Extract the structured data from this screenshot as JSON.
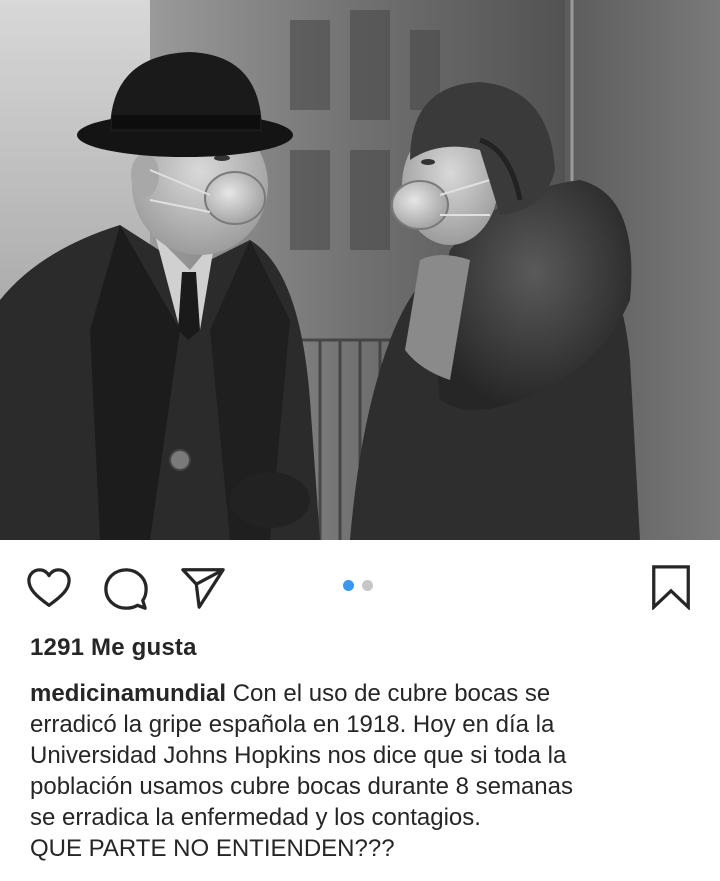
{
  "post": {
    "image": {
      "alt": "",
      "style": "black-and-white"
    },
    "actions": {
      "like_icon": "heart-icon",
      "comment_icon": "comment-icon",
      "share_icon": "send-icon",
      "save_icon": "bookmark-icon"
    },
    "carousel": {
      "total": 2,
      "active_index": 0,
      "active_color": "#3897f0",
      "inactive_color": "#c7c7c7"
    },
    "likes_text": "1291 Me gusta",
    "caption": {
      "username": "medicinamundial",
      "first_line": "Con el uso de cubre bocas se",
      "lines": [
        "erradicó la gripe española en 1918. Hoy en día la",
        "Universidad Johns Hopkins nos dice que si toda la",
        "población usamos cubre bocas durante 8 semanas",
        "se erradica la enfermedad y los contagios.",
        "QUE PARTE NO ENTIENDEN???"
      ]
    }
  }
}
